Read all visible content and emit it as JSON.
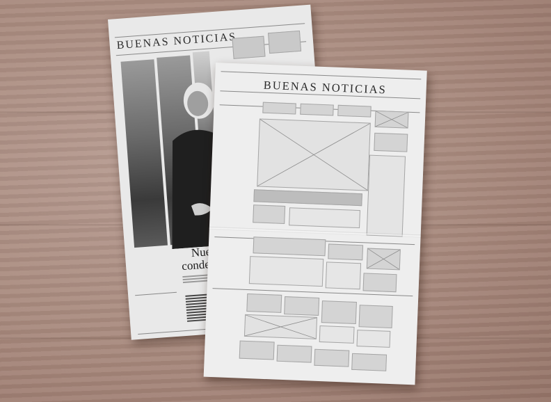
{
  "scene": {
    "description_free": true,
    "back_paper": {
      "masthead": "BUENAS NOTICIAS",
      "headline_line1": "Nuev",
      "headline_line2": "condena"
    },
    "front_paper": {
      "masthead": "BUENAS NOTICIAS"
    }
  },
  "colors": {
    "table": "#a8897d",
    "paper": "#ececec",
    "placeholder": "#d4d4d4",
    "placeholder_border": "#a5a5a5"
  }
}
